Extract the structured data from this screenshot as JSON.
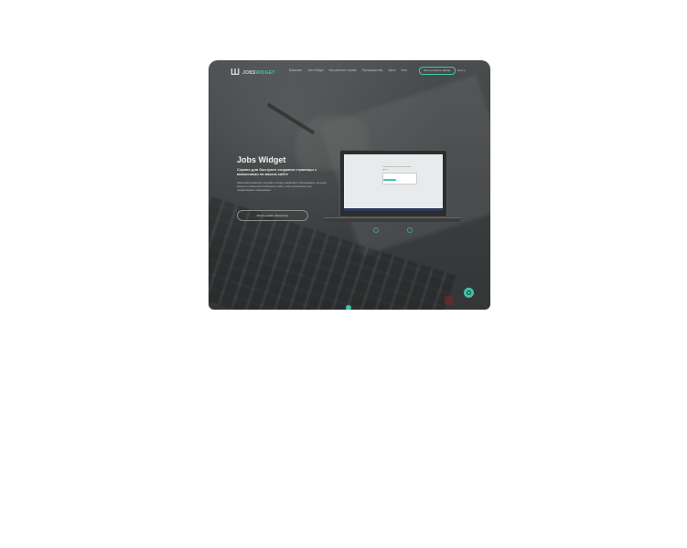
{
  "brand": {
    "logo_text_main": "JOBS",
    "logo_text_accent": "WIDGET",
    "accent_color": "#3fc6a8"
  },
  "nav": {
    "links": [
      "Вакансии",
      "Jobs Widget",
      "Как работает сервис",
      "Преимущества",
      "Цены",
      "Блог"
    ],
    "cta_label": "Использовать сейчас",
    "login_label": "Войти"
  },
  "hero": {
    "title": "Jobs Widget",
    "subtitle": "Сервис для быстрого создания страницы с вакансиями на вашем сайте",
    "description": "Размещайте вакансии, получайте отклики, назначайте собеседования. Не нужно вникать в технические особенности сайта, чтобы опубликовать или отредактировать информацию.",
    "button_label": "Использовать бесплатно"
  },
  "laptop_form": {
    "title": "Заполните данные и мы вышлем доступ"
  },
  "icons": {
    "chat": "chat-icon",
    "logo": "jobswidget-logo-icon"
  }
}
